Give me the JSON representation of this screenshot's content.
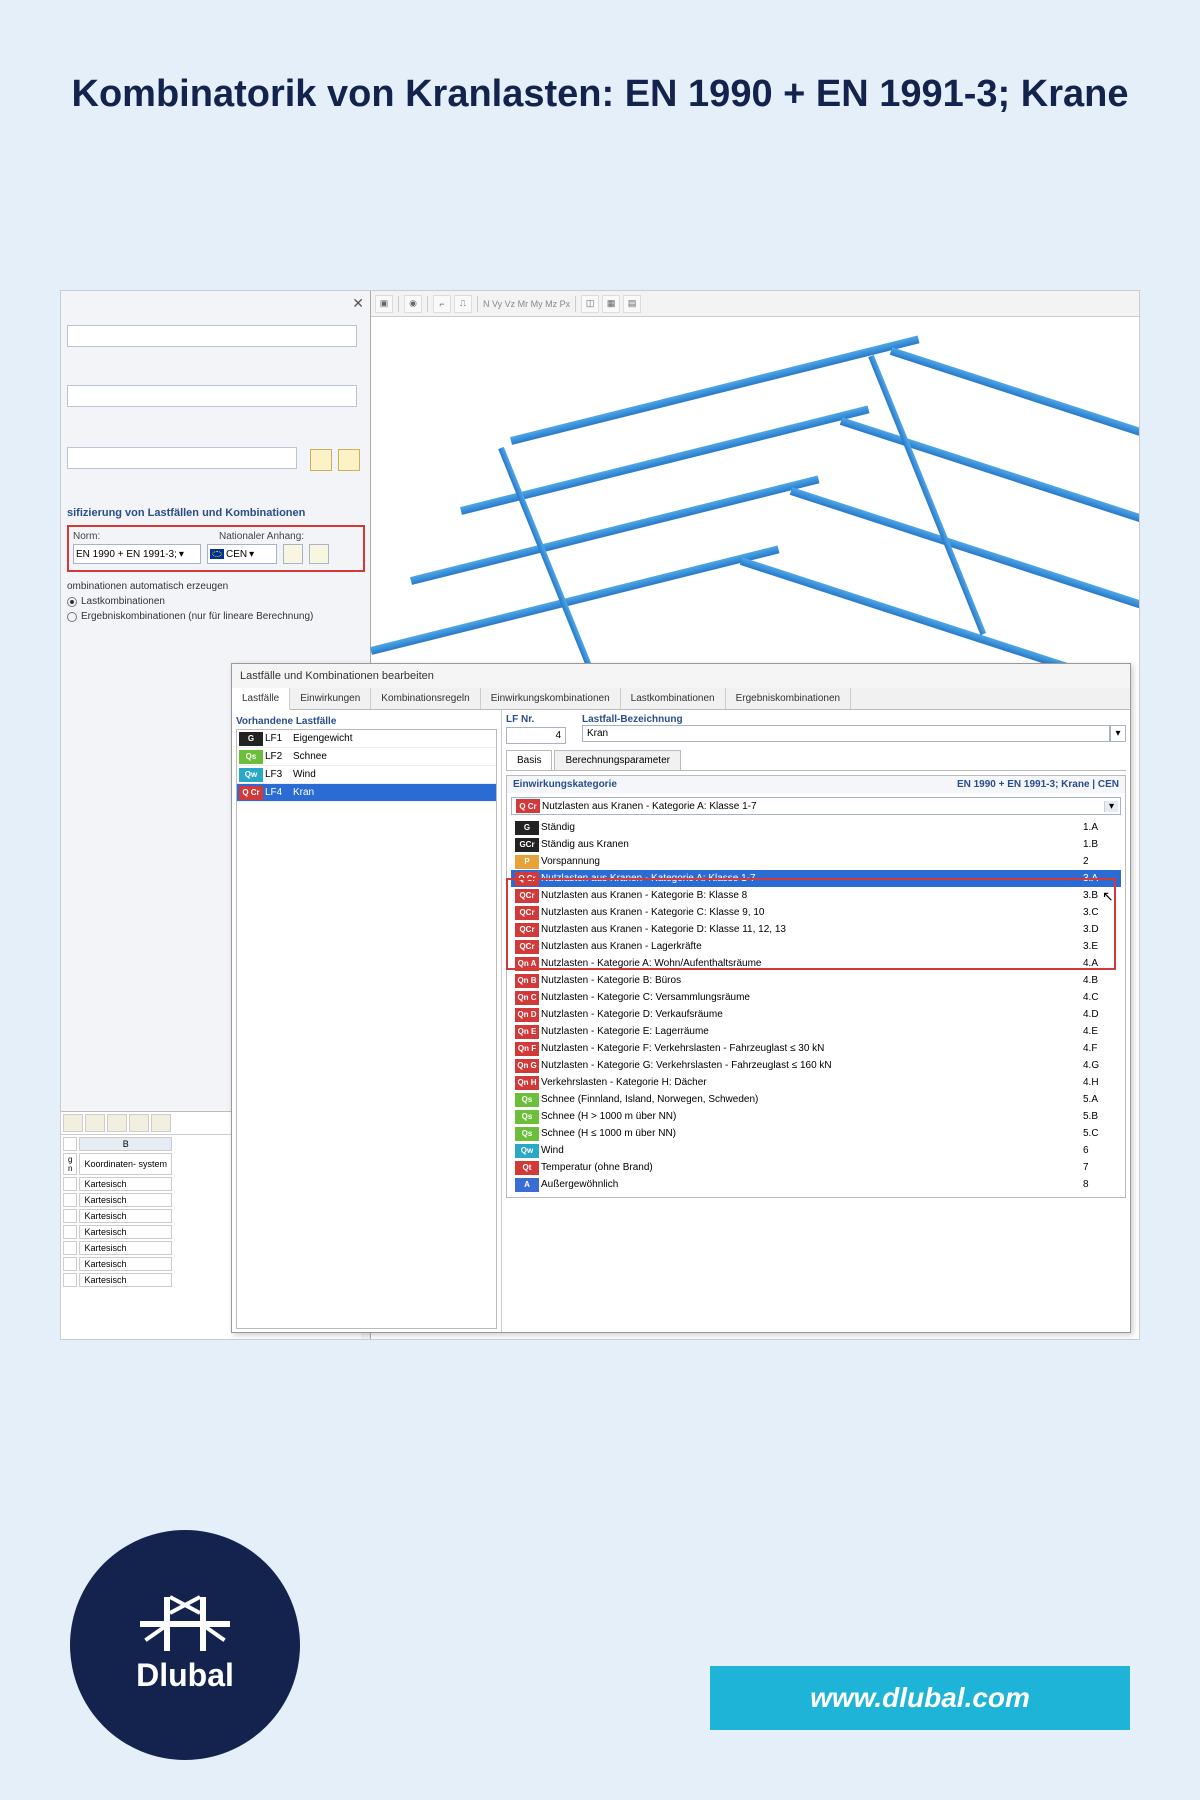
{
  "title": "Kombinatorik von Kranlasten: EN 1990 + EN 1991-3; Krane",
  "brand": "Dlubal",
  "url": "www.dlubal.com",
  "panel": {
    "section_classify": "sifizierung von Lastfällen und Kombinationen",
    "norm_label": "Norm:",
    "norm_value": "EN 1990 + EN 1991-3;",
    "annex_label": "Nationaler Anhang:",
    "annex_value": "CEN",
    "auto_create": "ombinationen automatisch erzeugen",
    "radio1": "Lastkombinationen",
    "radio2": "Ergebniskombinationen (nur für lineare Berechnung)"
  },
  "dialog": {
    "title": "Lastfälle und Kombinationen bearbeiten",
    "tabs": [
      "Lastfälle",
      "Einwirkungen",
      "Kombinationsregeln",
      "Einwirkungskombinationen",
      "Lastkombinationen",
      "Ergebniskombinationen"
    ],
    "active_tab": 0,
    "lf_header": "Vorhandene Lastfälle",
    "lf_items": [
      {
        "badge": "G",
        "bg": "#222",
        "code": "LF1",
        "name": "Eigengewicht"
      },
      {
        "badge": "Qs",
        "bg": "#6bbf3a",
        "code": "LF2",
        "name": "Schnee"
      },
      {
        "badge": "Qw",
        "bg": "#2aa8c8",
        "code": "LF3",
        "name": "Wind"
      },
      {
        "badge": "Q Cr",
        "bg": "#d23a3a",
        "code": "LF4",
        "name": "Kran",
        "sel": true
      }
    ],
    "nr_label": "LF Nr.",
    "nr_value": "4",
    "name_label": "Lastfall-Bezeichnung",
    "name_value": "Kran",
    "subtabs": [
      "Basis",
      "Berechnungsparameter"
    ],
    "cat_label": "Einwirkungskategorie",
    "cat_context": "EN 1990 + EN 1991-3; Krane | CEN",
    "cat_selected": "Nutzlasten aus Kranen - Kategorie A: Klasse 1-7",
    "categories": [
      {
        "b": "G",
        "bg": "#222",
        "t": "Ständig",
        "c": "1.A"
      },
      {
        "b": "GCr",
        "bg": "#222",
        "t": "Ständig aus Kranen",
        "c": "1.B"
      },
      {
        "b": "P",
        "bg": "#e8a23a",
        "t": "Vorspannung",
        "c": "2"
      },
      {
        "b": "Q Cr",
        "bg": "#d23a3a",
        "t": "Nutzlasten aus Kranen - Kategorie A: Klasse 1-7",
        "c": "3.A",
        "hl": true
      },
      {
        "b": "QCr",
        "bg": "#d23a3a",
        "t": "Nutzlasten aus Kranen - Kategorie B: Klasse 8",
        "c": "3.B"
      },
      {
        "b": "QCr",
        "bg": "#d23a3a",
        "t": "Nutzlasten aus Kranen - Kategorie C: Klasse 9, 10",
        "c": "3.C"
      },
      {
        "b": "QCr",
        "bg": "#d23a3a",
        "t": "Nutzlasten aus Kranen - Kategorie D: Klasse 11, 12, 13",
        "c": "3.D"
      },
      {
        "b": "QCr",
        "bg": "#d23a3a",
        "t": "Nutzlasten aus Kranen - Lagerkräfte",
        "c": "3.E"
      },
      {
        "b": "Qn A",
        "bg": "#d23a3a",
        "t": "Nutzlasten - Kategorie A: Wohn/Aufenthaltsräume",
        "c": "4.A"
      },
      {
        "b": "Qn B",
        "bg": "#d23a3a",
        "t": "Nutzlasten - Kategorie B: Büros",
        "c": "4.B"
      },
      {
        "b": "Qn C",
        "bg": "#d23a3a",
        "t": "Nutzlasten - Kategorie C: Versammlungsräume",
        "c": "4.C"
      },
      {
        "b": "Qn D",
        "bg": "#d23a3a",
        "t": "Nutzlasten - Kategorie D: Verkaufsräume",
        "c": "4.D"
      },
      {
        "b": "Qn E",
        "bg": "#d23a3a",
        "t": "Nutzlasten - Kategorie E: Lagerräume",
        "c": "4.E"
      },
      {
        "b": "Qn F",
        "bg": "#d23a3a",
        "t": "Nutzlasten - Kategorie F: Verkehrslasten - Fahrzeuglast ≤ 30 kN",
        "c": "4.F"
      },
      {
        "b": "Qn G",
        "bg": "#d23a3a",
        "t": "Nutzlasten - Kategorie G: Verkehrslasten - Fahrzeuglast ≤ 160 kN",
        "c": "4.G"
      },
      {
        "b": "Qn H",
        "bg": "#d23a3a",
        "t": "Verkehrslasten - Kategorie H: Dächer",
        "c": "4.H"
      },
      {
        "b": "Qs",
        "bg": "#6bbf3a",
        "t": "Schnee (Finnland, Island, Norwegen, Schweden)",
        "c": "5.A"
      },
      {
        "b": "Qs",
        "bg": "#6bbf3a",
        "t": "Schnee (H > 1000 m über NN)",
        "c": "5.B"
      },
      {
        "b": "Qs",
        "bg": "#6bbf3a",
        "t": "Schnee (H ≤ 1000 m über NN)",
        "c": "5.C"
      },
      {
        "b": "Qw",
        "bg": "#2aa8c8",
        "t": "Wind",
        "c": "6"
      },
      {
        "b": "Qt",
        "bg": "#d23a3a",
        "t": "Temperatur (ohne Brand)",
        "c": "7"
      },
      {
        "b": "A",
        "bg": "#3a6cd2",
        "t": "Außergewöhnlich",
        "c": "8"
      }
    ]
  },
  "grid": {
    "col_b": "B",
    "col_b_sub": "Koordinaten-\nsystem",
    "rows": [
      "Kartesisch",
      "Kartesisch",
      "Kartesisch",
      "Kartesisch",
      "Kartesisch",
      "Kartesisch",
      "Kartesisch"
    ]
  }
}
